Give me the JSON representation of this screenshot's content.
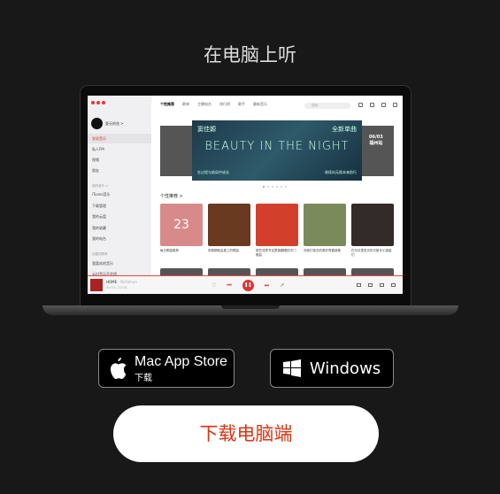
{
  "heading": "在电脑上听",
  "app": {
    "user": "夏天的花 >",
    "sidebar": [
      {
        "label": "发现音乐",
        "active": true
      },
      {
        "label": "私人FM"
      },
      {
        "label": "视频"
      },
      {
        "label": "朋友"
      }
    ],
    "my_music_header": "我的音乐 >",
    "my_music": [
      {
        "label": "iTunes音乐"
      },
      {
        "label": "下载管理"
      },
      {
        "label": "我的云盘"
      },
      {
        "label": "我的收藏"
      },
      {
        "label": "我的电台"
      }
    ],
    "playlists_header": "创建的歌单",
    "playlists": [
      {
        "label": "我喜欢的音乐"
      },
      {
        "label": "云村音乐不会停"
      }
    ],
    "tabs": [
      "个性推荐",
      "歌单",
      "主播电台",
      "排行榜",
      "歌手",
      "最新音乐"
    ],
    "search_placeholder": "搜索",
    "banner": {
      "artist": "窦佳嫄",
      "tag": "全新单曲",
      "title": "BEAUTY IN THE NIGHT",
      "sub_left": "在过程与结局中成长",
      "sub_right": "继续向无限未来前行",
      "side_date": "06/03",
      "side_city": "福州站"
    },
    "section_title": "个性推荐 >",
    "cards": [
      {
        "caption": "每日歌曲推荐",
        "day": "23",
        "color": "#d88a8a"
      },
      {
        "caption": "听假期就会爱上的歌曲",
        "color": "#6a3a20"
      },
      {
        "caption": "那些流秀节目里被翻唱的冷门歌曲",
        "color": "#d2402c"
      },
      {
        "caption": "向我们逝去的美好青春致敬",
        "color": "#7a8a5a"
      },
      {
        "caption": "在乐队里发光的贝斯手小姐姐们",
        "color": "#332a2a"
      }
    ],
    "player": {
      "title": "HOME",
      "artist": "- Nichkhun",
      "time": "00:54 / 02:28"
    }
  },
  "buttons": {
    "mac_line1": "Mac App Store",
    "mac_line2": "下载",
    "windows": "Windows",
    "download": "下载电脑端"
  },
  "colors": {
    "accent": "#d33a31",
    "background": "#181818"
  }
}
